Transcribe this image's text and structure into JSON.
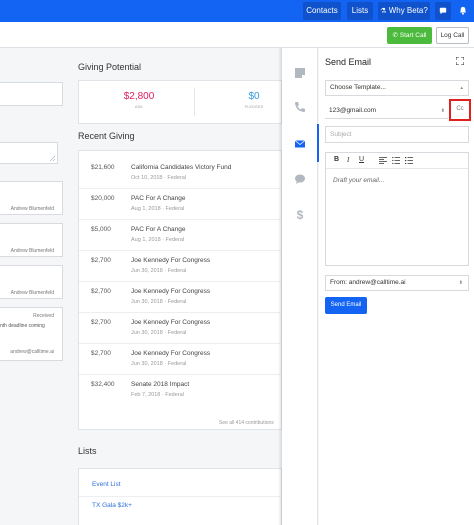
{
  "topnav": {
    "contacts": "Contacts",
    "lists": "Lists",
    "why_beta": "Why Beta?"
  },
  "header": {
    "start_call": "Start Call",
    "log_call": "Log Call"
  },
  "left": {
    "person1": "Andrew Blumenfeld",
    "person2": "Andrew Blumenfeld",
    "person3": "Andrew Blumenfeld",
    "received": "Received",
    "deadline": "nth deadline coming",
    "user": "andrew@calltime.ai"
  },
  "giving_potential": {
    "title": "Giving Potential",
    "ask_value": "$2,800",
    "ask_label": "ASK",
    "pledged_value": "$0",
    "pledged_label": "PLEDGED"
  },
  "recent_giving": {
    "title": "Recent Giving",
    "items": [
      {
        "amount": "$21,600",
        "name": "California Candidates Victory Fund",
        "sub": "Oct 10, 2018 · Federal"
      },
      {
        "amount": "$20,000",
        "name": "PAC For A Change",
        "sub": "Aug 1, 2018 · Federal"
      },
      {
        "amount": "$5,000",
        "name": "PAC For A Change",
        "sub": "Aug 1, 2018 · Federal"
      },
      {
        "amount": "$2,700",
        "name": "Joe Kennedy For Congress",
        "sub": "Jun 30, 2018 · Federal"
      },
      {
        "amount": "$2,700",
        "name": "Joe Kennedy For Congress",
        "sub": "Jun 30, 2018 · Federal"
      },
      {
        "amount": "$2,700",
        "name": "Joe Kennedy For Congress",
        "sub": "Jun 30, 2018 · Federal"
      },
      {
        "amount": "$2,700",
        "name": "Joe Kennedy For Congress",
        "sub": "Jun 30, 2018 · Federal"
      },
      {
        "amount": "$32,400",
        "name": "Senate 2018 Impact",
        "sub": "Feb 7, 2018 · Federal"
      }
    ],
    "see_all": "See all 414 contributions"
  },
  "lists": {
    "title": "Lists",
    "items": [
      "Event List",
      "TX Gala $2k+"
    ]
  },
  "send_email": {
    "title": "Send Email",
    "template_placeholder": "Choose Template...",
    "to_email": "123@gmail.com",
    "cc_label": "Cc",
    "subject_placeholder": "Subject",
    "draft_placeholder": "Draft your email...",
    "from": "From: andrew@calltime.ai",
    "send": "Send Email",
    "toolbar": {
      "bold": "B",
      "italic": "I",
      "underline": "U"
    }
  }
}
